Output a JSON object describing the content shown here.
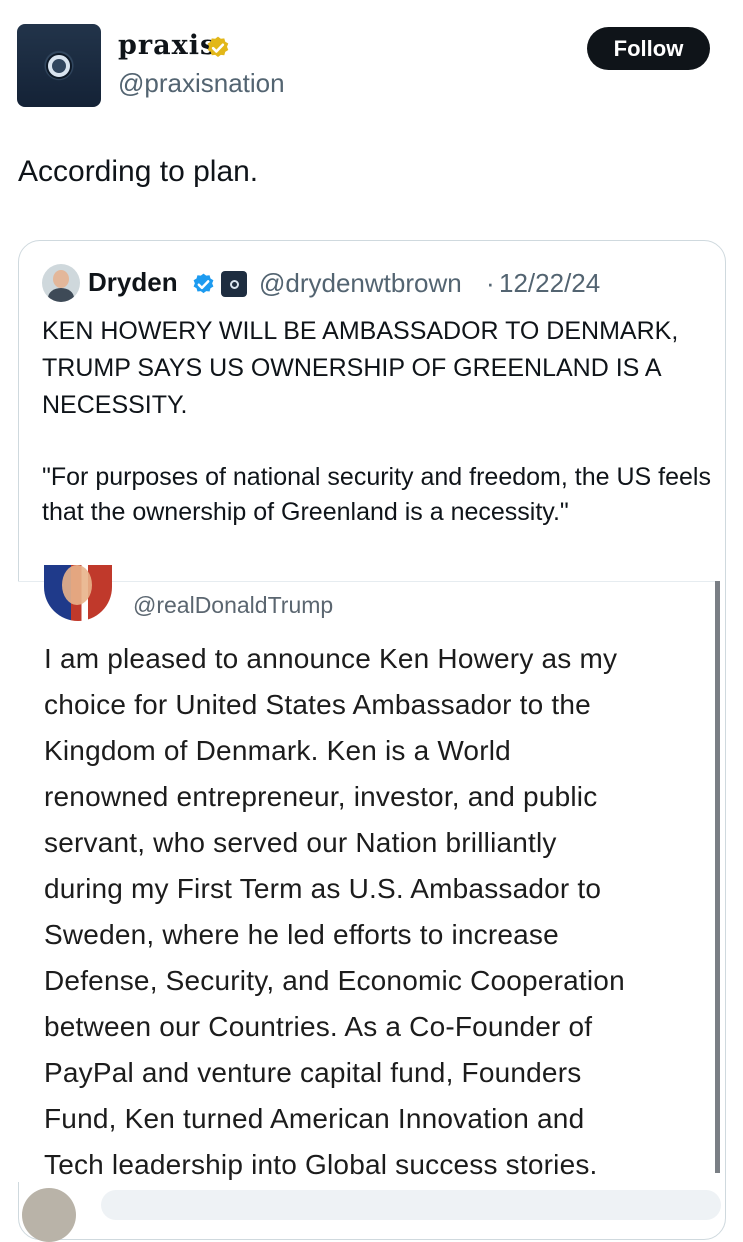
{
  "tweet": {
    "author": {
      "display_name": "praxis",
      "handle": "@praxisnation",
      "verified_badge": "gold-check-icon"
    },
    "follow_label": "Follow",
    "text": "According to plan."
  },
  "quote": {
    "author": {
      "display_name": "Dryden",
      "handle": "@drydenwtbrown",
      "separator": "·",
      "date": "12/22/24",
      "verified_badge": "blue-check-icon"
    },
    "headline": "KEN HOWERY WILL BE AMBASSADOR TO DENMARK, TRUMP SAYS US OWNERSHIP OF GREENLAND IS A NECESSITY.",
    "quote_text": "\"For purposes of national security and freedom, the US feels that the ownership of Greenland is a necessity.\"",
    "embedded_post": {
      "handle": "@realDonaldTrump",
      "lines": [
        "I am pleased to announce Ken Howery as my",
        "choice for United States Ambassador to the",
        "Kingdom of Denmark. Ken is a World",
        "renowned entrepreneur, investor, and public",
        "servant, who served our Nation brilliantly",
        "during my First Term as U.S. Ambassador to",
        "Sweden, where he led efforts to increase",
        "Defense, Security, and Economic Cooperation",
        "between our Countries. As a Co-Founder of",
        "PayPal and venture capital fund, Founders",
        "Fund, Ken turned American Innovation and",
        "Tech leadership into Global success stories."
      ]
    }
  },
  "colors": {
    "text": "#0f1419",
    "secondary": "#536471",
    "verified_blue": "#1d9bf0",
    "verified_gold": "#e2b719",
    "follow_bg": "#0f1419"
  }
}
